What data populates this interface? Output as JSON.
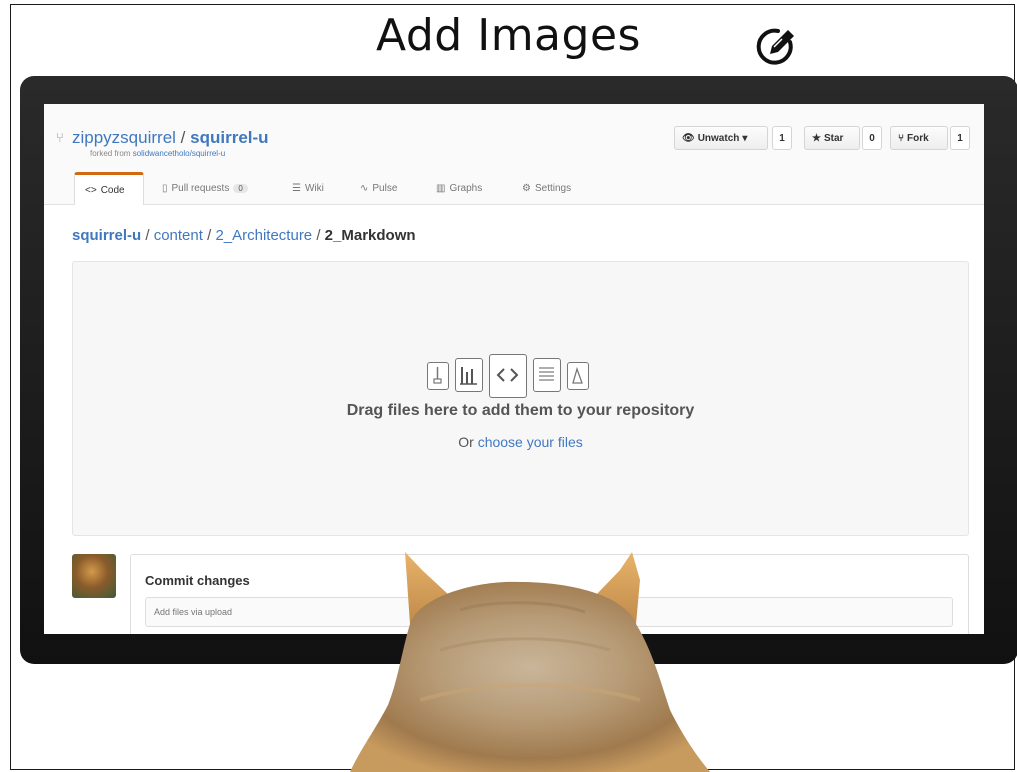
{
  "slide": {
    "title": "Add Images",
    "title_icon": "edit-circle-icon"
  },
  "repo": {
    "owner": "zippyzsquirrel",
    "separator": "/",
    "name": "squirrel-u",
    "forked_from_label": "forked from",
    "forked_from_repo": "solidwancetholo/squirrel-u"
  },
  "header_actions": {
    "unwatch_label": "Unwatch",
    "unwatch_count": "1",
    "star_label": "Star",
    "star_count": "0",
    "fork_label": "Fork",
    "fork_count": "1"
  },
  "tabs": [
    {
      "label": "Code",
      "icon": "code-icon",
      "selected": true
    },
    {
      "label": "Pull requests",
      "icon": "pull-request-icon",
      "count": "0"
    },
    {
      "label": "Wiki",
      "icon": "wiki-icon"
    },
    {
      "label": "Pulse",
      "icon": "pulse-icon"
    },
    {
      "label": "Graphs",
      "icon": "graph-icon"
    },
    {
      "label": "Settings",
      "icon": "gear-icon"
    }
  ],
  "breadcrumb": {
    "root": "squirrel-u",
    "sep": "/",
    "part1": "content",
    "part2": "2_Architecture",
    "final": "2_Markdown"
  },
  "dropzone": {
    "main_text": "Drag files here to add them to your repository",
    "or_text": "Or",
    "choose_link": "choose your files",
    "icons": [
      "zip-file-icon",
      "chart-file-icon",
      "code-file-icon",
      "text-file-icon",
      "pdf-file-icon"
    ]
  },
  "commit": {
    "title": "Commit changes",
    "placeholder": "Add files via upload"
  },
  "colors": {
    "link": "#4078c0",
    "tab_accent": "#d26911",
    "monitor_bezel": "#1b1b1b"
  }
}
